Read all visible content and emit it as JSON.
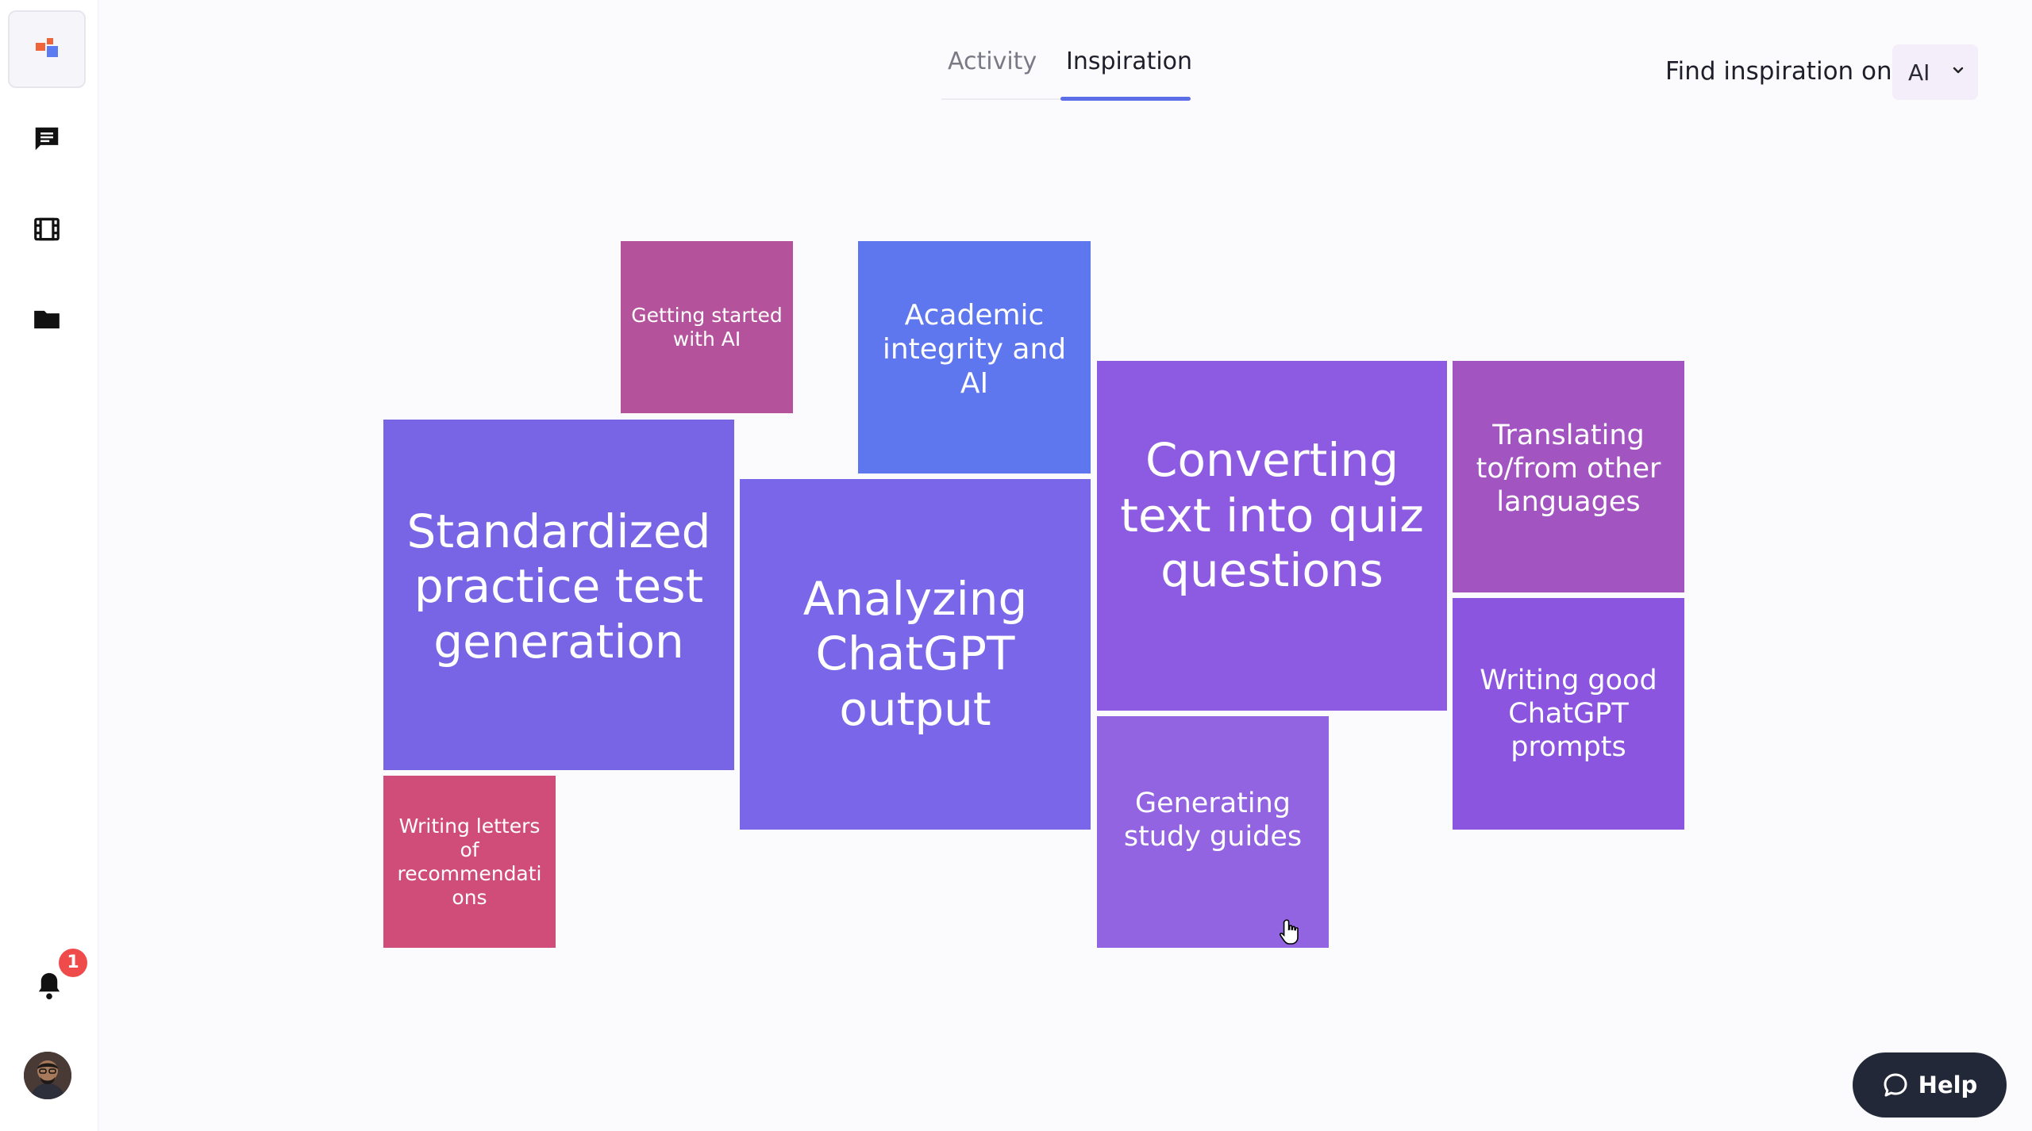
{
  "sidebar": {
    "logo": {
      "colors": [
        "#f0643a",
        "#5b7cf0"
      ]
    },
    "items": [
      {
        "name": "chat-icon"
      },
      {
        "name": "film-icon"
      },
      {
        "name": "folder-icon"
      }
    ],
    "notifications": {
      "count": "1"
    },
    "avatar": {
      "name": "avatar"
    }
  },
  "header": {
    "tabs": [
      {
        "label": "Activity",
        "active": false
      },
      {
        "label": "Inspiration",
        "active": true
      }
    ],
    "find_label": "Find inspiration on",
    "topic_select": {
      "value": "AI"
    }
  },
  "tiles": [
    {
      "label": "Getting started with AI",
      "color": "#b4539c"
    },
    {
      "label": "Academic integrity and AI",
      "color": "#5e77ee"
    },
    {
      "label": "Standardized practice test generation",
      "color": "#7865e6"
    },
    {
      "label": "Analyzing ChatGPT output",
      "color": "#7966e8"
    },
    {
      "label": "Converting text into quiz questions",
      "color": "#8c5be1"
    },
    {
      "label": "Translating to/from other languages",
      "color": "#a255c0"
    },
    {
      "label": "Writing good ChatGPT prompts",
      "color": "#8b55e0"
    },
    {
      "label": "Writing letters of recommendations",
      "color": "#d04d79"
    },
    {
      "label": "Generating study guides",
      "color": "#9364e2"
    }
  ],
  "help": {
    "label": "Help"
  }
}
